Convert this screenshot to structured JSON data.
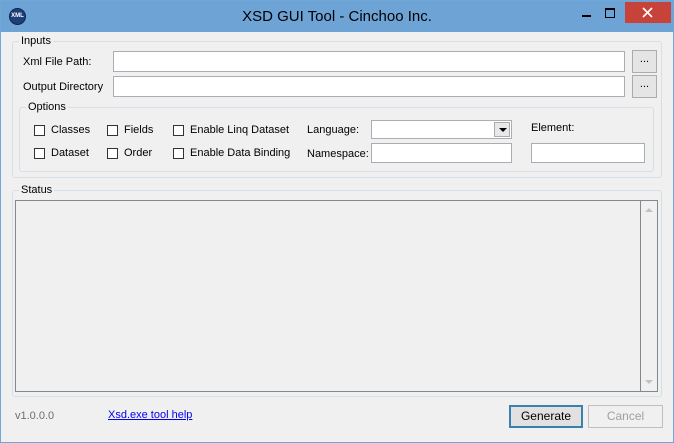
{
  "window": {
    "title": "XSD GUI Tool - Cinchoo Inc.",
    "app_icon_text": "XML"
  },
  "inputs": {
    "legend": "Inputs",
    "xml_file_path": {
      "label": "Xml File Path:",
      "value": "",
      "browse_label": "..."
    },
    "output_directory": {
      "label": "Output Directory",
      "value": "",
      "browse_label": "..."
    }
  },
  "options": {
    "legend": "Options",
    "checkboxes": {
      "classes": {
        "label": "Classes",
        "checked": false
      },
      "fields": {
        "label": "Fields",
        "checked": false
      },
      "enable_linq_dataset": {
        "label": "Enable Linq Dataset",
        "checked": false
      },
      "dataset": {
        "label": "Dataset",
        "checked": false
      },
      "order": {
        "label": "Order",
        "checked": false
      },
      "enable_data_binding": {
        "label": "Enable Data Binding",
        "checked": false
      }
    },
    "language": {
      "label": "Language:",
      "selected": ""
    },
    "namespace": {
      "label": "Namespace:",
      "value": ""
    },
    "element": {
      "label": "Element:",
      "value": ""
    }
  },
  "status": {
    "legend": "Status",
    "text": ""
  },
  "footer": {
    "version": "v1.0.0.0",
    "help_link": "Xsd.exe tool help",
    "generate_label": "Generate",
    "cancel_label": "Cancel"
  },
  "colors": {
    "titlebar": "#6ea3d6",
    "close_button": "#c74238",
    "link": "#0000ee",
    "default_button_border": "#3c7fb1"
  }
}
